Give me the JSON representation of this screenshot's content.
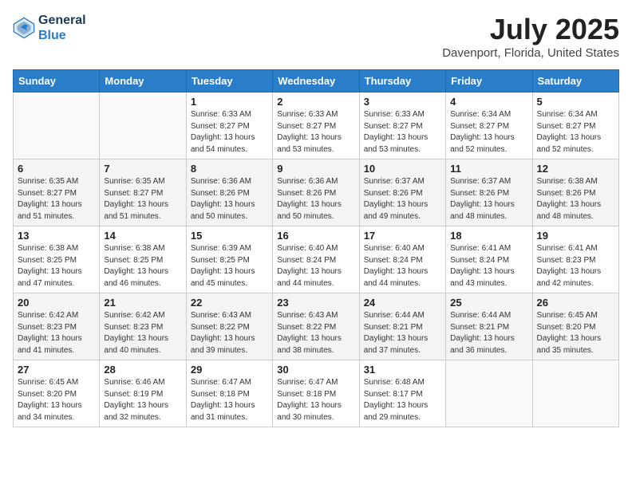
{
  "header": {
    "logo_line1": "General",
    "logo_line2": "Blue",
    "month": "July 2025",
    "location": "Davenport, Florida, United States"
  },
  "weekdays": [
    "Sunday",
    "Monday",
    "Tuesday",
    "Wednesday",
    "Thursday",
    "Friday",
    "Saturday"
  ],
  "weeks": [
    [
      {
        "day": "",
        "info": ""
      },
      {
        "day": "",
        "info": ""
      },
      {
        "day": "1",
        "info": "Sunrise: 6:33 AM\nSunset: 8:27 PM\nDaylight: 13 hours and 54 minutes."
      },
      {
        "day": "2",
        "info": "Sunrise: 6:33 AM\nSunset: 8:27 PM\nDaylight: 13 hours and 53 minutes."
      },
      {
        "day": "3",
        "info": "Sunrise: 6:33 AM\nSunset: 8:27 PM\nDaylight: 13 hours and 53 minutes."
      },
      {
        "day": "4",
        "info": "Sunrise: 6:34 AM\nSunset: 8:27 PM\nDaylight: 13 hours and 52 minutes."
      },
      {
        "day": "5",
        "info": "Sunrise: 6:34 AM\nSunset: 8:27 PM\nDaylight: 13 hours and 52 minutes."
      }
    ],
    [
      {
        "day": "6",
        "info": "Sunrise: 6:35 AM\nSunset: 8:27 PM\nDaylight: 13 hours and 51 minutes."
      },
      {
        "day": "7",
        "info": "Sunrise: 6:35 AM\nSunset: 8:27 PM\nDaylight: 13 hours and 51 minutes."
      },
      {
        "day": "8",
        "info": "Sunrise: 6:36 AM\nSunset: 8:26 PM\nDaylight: 13 hours and 50 minutes."
      },
      {
        "day": "9",
        "info": "Sunrise: 6:36 AM\nSunset: 8:26 PM\nDaylight: 13 hours and 50 minutes."
      },
      {
        "day": "10",
        "info": "Sunrise: 6:37 AM\nSunset: 8:26 PM\nDaylight: 13 hours and 49 minutes."
      },
      {
        "day": "11",
        "info": "Sunrise: 6:37 AM\nSunset: 8:26 PM\nDaylight: 13 hours and 48 minutes."
      },
      {
        "day": "12",
        "info": "Sunrise: 6:38 AM\nSunset: 8:26 PM\nDaylight: 13 hours and 48 minutes."
      }
    ],
    [
      {
        "day": "13",
        "info": "Sunrise: 6:38 AM\nSunset: 8:25 PM\nDaylight: 13 hours and 47 minutes."
      },
      {
        "day": "14",
        "info": "Sunrise: 6:38 AM\nSunset: 8:25 PM\nDaylight: 13 hours and 46 minutes."
      },
      {
        "day": "15",
        "info": "Sunrise: 6:39 AM\nSunset: 8:25 PM\nDaylight: 13 hours and 45 minutes."
      },
      {
        "day": "16",
        "info": "Sunrise: 6:40 AM\nSunset: 8:24 PM\nDaylight: 13 hours and 44 minutes."
      },
      {
        "day": "17",
        "info": "Sunrise: 6:40 AM\nSunset: 8:24 PM\nDaylight: 13 hours and 44 minutes."
      },
      {
        "day": "18",
        "info": "Sunrise: 6:41 AM\nSunset: 8:24 PM\nDaylight: 13 hours and 43 minutes."
      },
      {
        "day": "19",
        "info": "Sunrise: 6:41 AM\nSunset: 8:23 PM\nDaylight: 13 hours and 42 minutes."
      }
    ],
    [
      {
        "day": "20",
        "info": "Sunrise: 6:42 AM\nSunset: 8:23 PM\nDaylight: 13 hours and 41 minutes."
      },
      {
        "day": "21",
        "info": "Sunrise: 6:42 AM\nSunset: 8:23 PM\nDaylight: 13 hours and 40 minutes."
      },
      {
        "day": "22",
        "info": "Sunrise: 6:43 AM\nSunset: 8:22 PM\nDaylight: 13 hours and 39 minutes."
      },
      {
        "day": "23",
        "info": "Sunrise: 6:43 AM\nSunset: 8:22 PM\nDaylight: 13 hours and 38 minutes."
      },
      {
        "day": "24",
        "info": "Sunrise: 6:44 AM\nSunset: 8:21 PM\nDaylight: 13 hours and 37 minutes."
      },
      {
        "day": "25",
        "info": "Sunrise: 6:44 AM\nSunset: 8:21 PM\nDaylight: 13 hours and 36 minutes."
      },
      {
        "day": "26",
        "info": "Sunrise: 6:45 AM\nSunset: 8:20 PM\nDaylight: 13 hours and 35 minutes."
      }
    ],
    [
      {
        "day": "27",
        "info": "Sunrise: 6:45 AM\nSunset: 8:20 PM\nDaylight: 13 hours and 34 minutes."
      },
      {
        "day": "28",
        "info": "Sunrise: 6:46 AM\nSunset: 8:19 PM\nDaylight: 13 hours and 32 minutes."
      },
      {
        "day": "29",
        "info": "Sunrise: 6:47 AM\nSunset: 8:18 PM\nDaylight: 13 hours and 31 minutes."
      },
      {
        "day": "30",
        "info": "Sunrise: 6:47 AM\nSunset: 8:18 PM\nDaylight: 13 hours and 30 minutes."
      },
      {
        "day": "31",
        "info": "Sunrise: 6:48 AM\nSunset: 8:17 PM\nDaylight: 13 hours and 29 minutes."
      },
      {
        "day": "",
        "info": ""
      },
      {
        "day": "",
        "info": ""
      }
    ]
  ]
}
